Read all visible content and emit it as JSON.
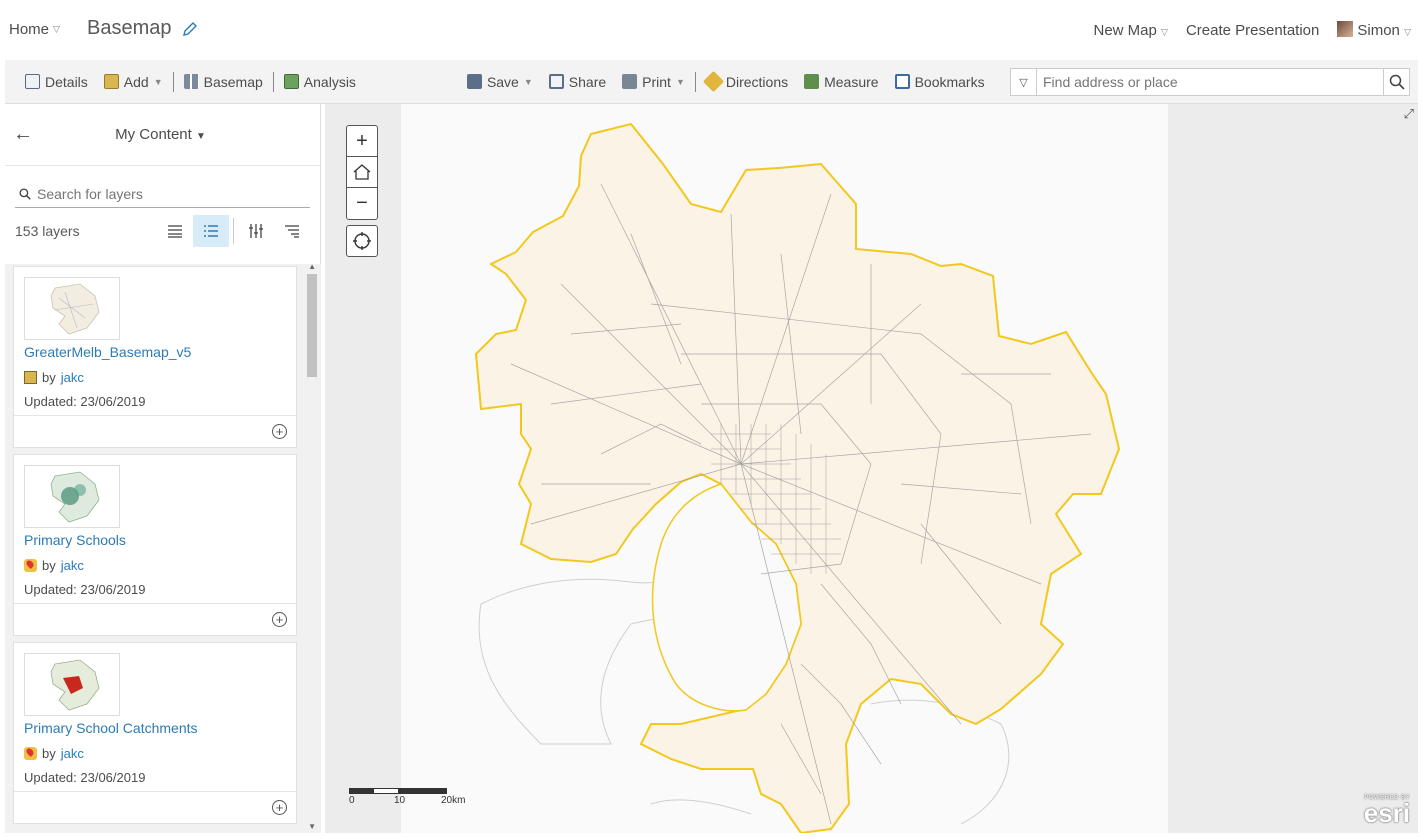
{
  "header": {
    "home_label": "Home",
    "map_title": "Basemap",
    "new_map_label": "New Map",
    "create_presentation_label": "Create Presentation",
    "user_name": "Simon"
  },
  "toolbar": {
    "details_label": "Details",
    "add_label": "Add",
    "basemap_label": "Basemap",
    "analysis_label": "Analysis",
    "save_label": "Save",
    "share_label": "Share",
    "print_label": "Print",
    "directions_label": "Directions",
    "measure_label": "Measure",
    "bookmarks_label": "Bookmarks",
    "search_placeholder": "Find address or place"
  },
  "panel": {
    "title": "My Content",
    "search_placeholder": "Search for layers",
    "layer_count": "153 layers",
    "items": [
      {
        "name": "GreaterMelb_Basemap_v5",
        "by": "by",
        "owner": "jakc",
        "updated": "Updated: 23/06/2019",
        "type_icon": "web-map-icon"
      },
      {
        "name": "Primary Schools",
        "by": "by",
        "owner": "jakc",
        "updated": "Updated: 23/06/2019",
        "type_icon": "feature-layer-icon"
      },
      {
        "name": "Primary School Catchments",
        "by": "by",
        "owner": "jakc",
        "updated": "Updated: 23/06/2019",
        "type_icon": "feature-layer-icon"
      }
    ]
  },
  "map": {
    "scale_labels": [
      "0",
      "10",
      "20km"
    ],
    "attribution_small": "POWERED BY",
    "attribution_logo": "esri",
    "boundary_color": "#f2c81d",
    "fill_color": "#fbf3e6",
    "road_color": "#9a9a9a"
  }
}
